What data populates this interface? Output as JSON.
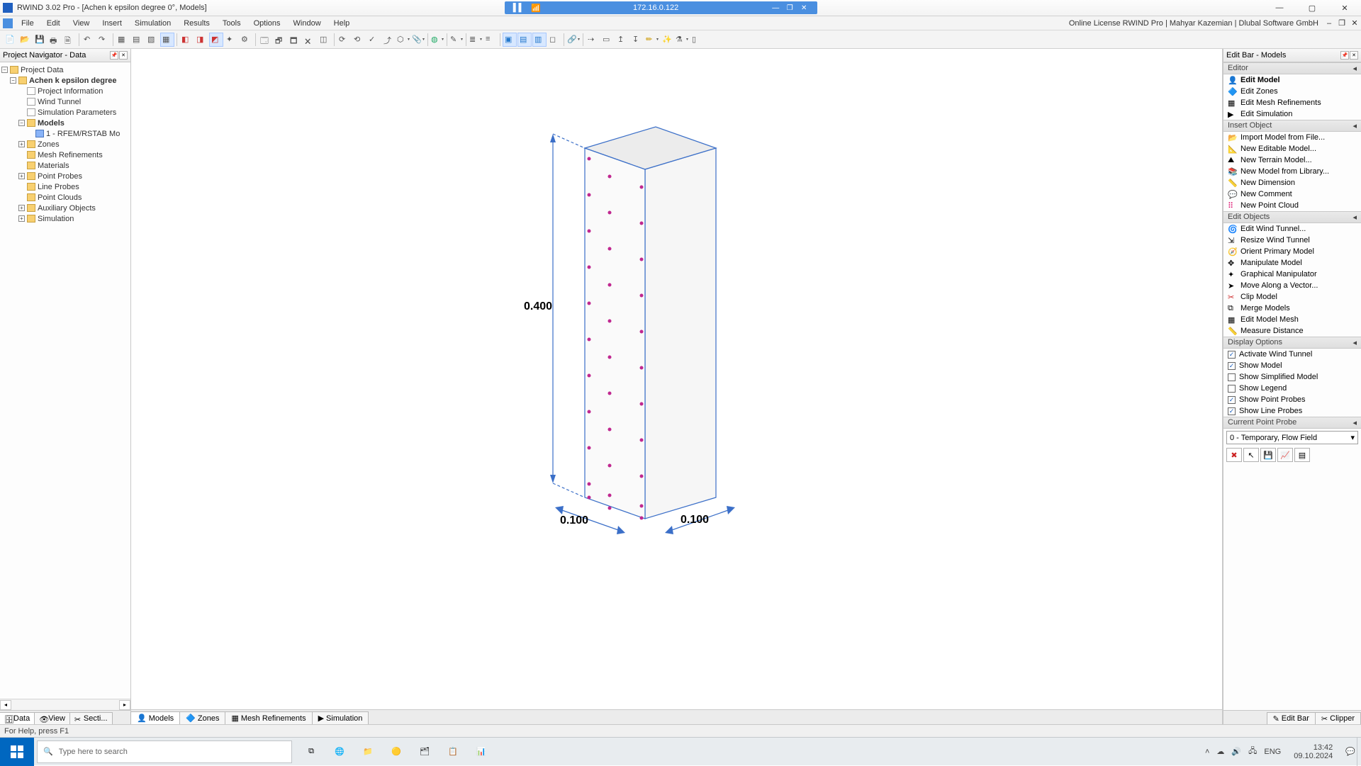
{
  "titlebar": {
    "title": "RWIND 3.02 Pro - [Achen  k epsilon degree 0°, Models]",
    "ip": "172.16.0.122"
  },
  "menubar": {
    "items": [
      "File",
      "Edit",
      "View",
      "Insert",
      "Simulation",
      "Results",
      "Tools",
      "Options",
      "Window",
      "Help"
    ],
    "license": "Online License RWIND Pro | Mahyar Kazemian | Dlubal Software GmbH"
  },
  "leftpanel": {
    "title": "Project Navigator - Data",
    "tree": {
      "root": "Project Data",
      "project": "Achen  k epsilon degree",
      "children": [
        "Project Information",
        "Wind Tunnel",
        "Simulation Parameters"
      ],
      "models_label": "Models",
      "model_items": [
        "1 - RFEM/RSTAB Mo"
      ],
      "rest": [
        "Zones",
        "Mesh Refinements",
        "Materials",
        "Point Probes",
        "Line Probes",
        "Point Clouds",
        "Auxiliary Objects",
        "Simulation"
      ]
    },
    "tabs": [
      "Data",
      "View",
      "Secti..."
    ]
  },
  "canvas": {
    "dim_height": "0.400",
    "dim_width": "0.100",
    "dim_depth": "0.100"
  },
  "centertabs": [
    "Models",
    "Zones",
    "Mesh Refinements",
    "Simulation"
  ],
  "rightpanel": {
    "title": "Edit Bar - Models",
    "sections": {
      "editor": "Editor",
      "insert": "Insert Object",
      "editobj": "Edit Objects",
      "display": "Display Options",
      "probe": "Current Point Probe"
    },
    "editor_items": [
      "Edit Model",
      "Edit Zones",
      "Edit Mesh Refinements",
      "Edit Simulation"
    ],
    "insert_items": [
      "Import Model from File...",
      "New Editable Model...",
      "New Terrain Model...",
      "New Model from Library...",
      "New Dimension",
      "New Comment",
      "New Point Cloud"
    ],
    "editobj_items": [
      "Edit Wind Tunnel...",
      "Resize Wind Tunnel",
      "Orient Primary Model",
      "Manipulate Model",
      "Graphical Manipulator",
      "Move Along a Vector...",
      "Clip Model",
      "Merge Models",
      "Edit Model Mesh",
      "Measure Distance"
    ],
    "display_items": [
      {
        "label": "Activate Wind Tunnel",
        "checked": true
      },
      {
        "label": "Show Model",
        "checked": true
      },
      {
        "label": "Show Simplified Model",
        "checked": false
      },
      {
        "label": "Show Legend",
        "checked": false
      },
      {
        "label": "Show Point Probes",
        "checked": true
      },
      {
        "label": "Show Line Probes",
        "checked": true
      }
    ],
    "probe_select": "0 - Temporary, Flow Field",
    "tabs": [
      "Edit Bar",
      "Clipper"
    ]
  },
  "statusbar": {
    "text": "For Help, press F1"
  },
  "taskbar": {
    "search_placeholder": "Type here to search",
    "lang1": "ENG",
    "time": "13:42",
    "date": "09.10.2024"
  }
}
